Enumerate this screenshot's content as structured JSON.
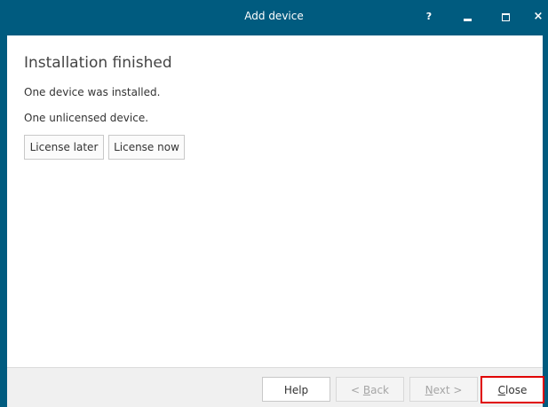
{
  "window": {
    "title": "Add device",
    "help_glyph": "?",
    "close_glyph": "×"
  },
  "content": {
    "heading": "Installation finished",
    "installed_text": "One device was installed.",
    "unlicensed_text": "One unlicensed device.",
    "license_later_label": "License later",
    "license_now_label": "License now"
  },
  "footer": {
    "help_label": "Help",
    "back_prefix": "< ",
    "back_mnemonic": "B",
    "back_rest": "ack",
    "next_mnemonic": "N",
    "next_rest": "ext >",
    "close_mnemonic": "C",
    "close_rest": "lose"
  },
  "colors": {
    "titlebar": "#005b7f",
    "highlight": "#e00000"
  }
}
